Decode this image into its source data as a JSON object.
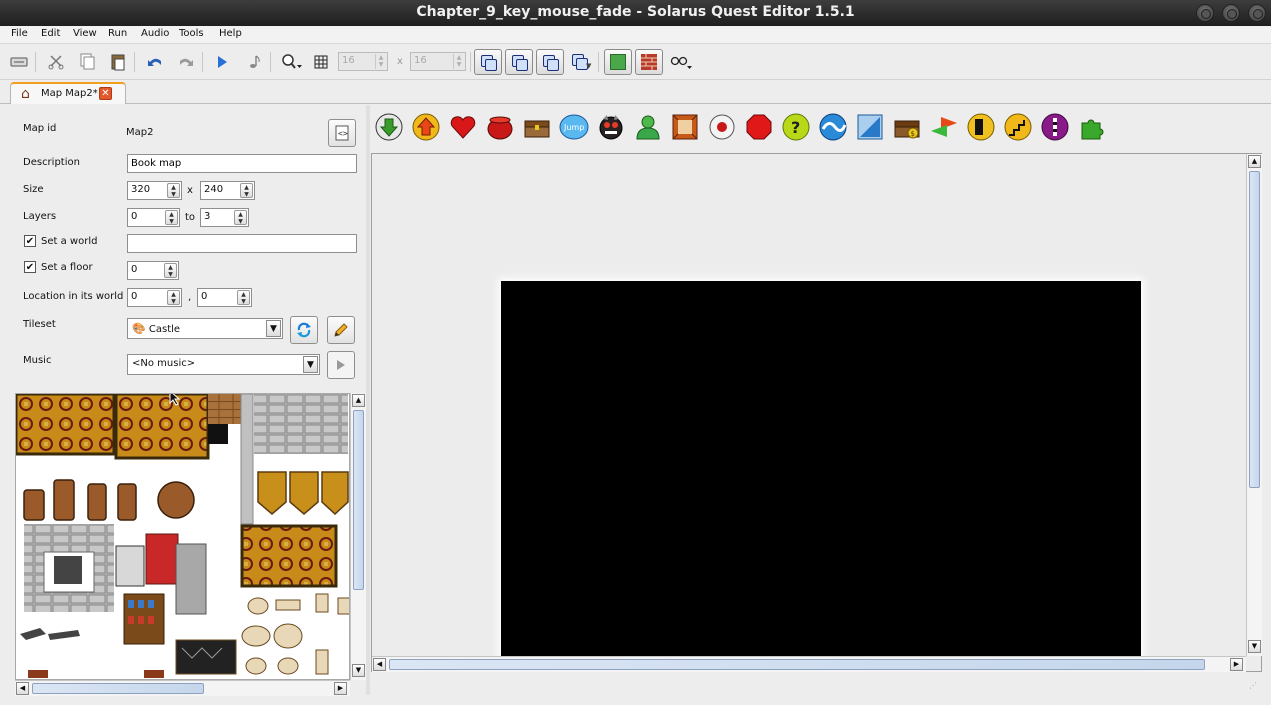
{
  "window": {
    "title": "Chapter_9_key_mouse_fade - Solarus Quest Editor 1.5.1"
  },
  "menu": [
    "File",
    "Edit",
    "View",
    "Run",
    "Audio",
    "Tools",
    "Help"
  ],
  "toolbar": {
    "grid_width": "16",
    "grid_height": "16",
    "times": "x"
  },
  "tab": {
    "label": "Map Map2*",
    "close": "✕"
  },
  "map_props": {
    "map_id_label": "Map id",
    "map_id_value": "Map2",
    "description_label": "Description",
    "description_value": "Book map",
    "size_label": "Size",
    "size_width": "320",
    "size_times": "x",
    "size_height": "240",
    "layers_label": "Layers",
    "layers_min": "0",
    "layers_to": "to",
    "layers_max": "3",
    "world_label": "Set a world",
    "world_checked": "✔",
    "world_value": "",
    "floor_label": "Set a floor",
    "floor_checked": "✔",
    "floor_value": "0",
    "location_label": "Location in its world",
    "location_x": "0",
    "location_sep": ",",
    "location_y": "0",
    "tileset_label": "Tileset",
    "tileset_value": "Castle",
    "music_label": "Music",
    "music_value": "<No music>"
  },
  "entity_palette": [
    {
      "name": "destination",
      "icon": "arrow-down-icon",
      "color": "#3a9a2a"
    },
    {
      "name": "teletransporter",
      "icon": "arrow-up-icon",
      "color": "#f0a000"
    },
    {
      "name": "pickable",
      "icon": "heart-icon",
      "color": "#d81818"
    },
    {
      "name": "destructible",
      "icon": "pot-icon",
      "color": "#b81818"
    },
    {
      "name": "chest",
      "icon": "chest-icon",
      "color": "#8a5a2a"
    },
    {
      "name": "jumper",
      "icon": "jump-icon",
      "color": "#4aa8e8",
      "text": "Jump"
    },
    {
      "name": "enemy",
      "icon": "enemy-icon",
      "color": "#3a2a2a"
    },
    {
      "name": "npc",
      "icon": "npc-icon",
      "color": "#3aa84a"
    },
    {
      "name": "block",
      "icon": "block-icon",
      "color": "#c85a18"
    },
    {
      "name": "switch",
      "icon": "switch-icon",
      "color": "#c81818"
    },
    {
      "name": "wall",
      "icon": "wall-icon",
      "color": "#e01818"
    },
    {
      "name": "sensor",
      "icon": "sensor-icon",
      "color": "#a8c818"
    },
    {
      "name": "crystal",
      "icon": "crystal-icon",
      "color": "#1878c8"
    },
    {
      "name": "crystal-block",
      "icon": "crystal-block-icon",
      "color": "#2a78c8"
    },
    {
      "name": "shop-treasure",
      "icon": "shop-icon",
      "color": "#8a5a2a"
    },
    {
      "name": "stream",
      "icon": "stream-icon",
      "color": "#e84818"
    },
    {
      "name": "door",
      "icon": "door-icon",
      "color": "#f0b818"
    },
    {
      "name": "stairs",
      "icon": "stairs-icon",
      "color": "#f0a818"
    },
    {
      "name": "separator",
      "icon": "separator-icon",
      "color": "#8a1a8a"
    },
    {
      "name": "custom-entity",
      "icon": "puzzle-icon",
      "color": "#3aa82a"
    }
  ]
}
